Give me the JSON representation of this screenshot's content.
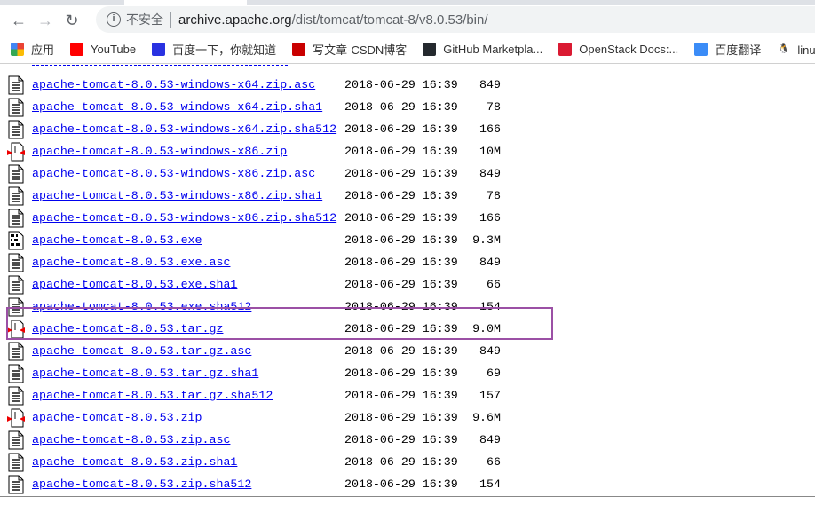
{
  "browser": {
    "back_icon": "arrow-left",
    "forward_icon": "arrow-right",
    "reload_icon": "reload",
    "security_label": "不安全",
    "url_host": "archive.apache.org",
    "url_path": "/dist/tomcat/tomcat-8/v8.0.53/bin/"
  },
  "bookmarks": [
    {
      "label": "应用",
      "icon": "apps-grid-icon",
      "color": "#4285f4"
    },
    {
      "label": "YouTube",
      "icon": "youtube-icon",
      "color": "#ff0000"
    },
    {
      "label": "百度一下，你就知道",
      "icon": "baidu-paw-icon",
      "color": "#2932e1"
    },
    {
      "label": "写文章-CSDN博客",
      "icon": "csdn-icon",
      "color": "#c90000"
    },
    {
      "label": "GitHub Marketpla...",
      "icon": "github-icon",
      "color": "#24292e"
    },
    {
      "label": "OpenStack Docs:...",
      "icon": "openstack-icon",
      "color": "#da1a32"
    },
    {
      "label": "百度翻译",
      "icon": "translate-icon",
      "color": "#3b8cf7"
    },
    {
      "label": "linux命",
      "icon": "linux-tux-icon",
      "color": "#333333"
    }
  ],
  "highlight_color": "#9b50a5",
  "files": [
    {
      "name": "apache-tomcat-8.0.53-windows-x64.zip.asc",
      "date": "2018-06-29 16:39",
      "size": "849",
      "type": "text"
    },
    {
      "name": "apache-tomcat-8.0.53-windows-x64.zip.sha1",
      "date": "2018-06-29 16:39",
      "size": "78",
      "type": "text"
    },
    {
      "name": "apache-tomcat-8.0.53-windows-x64.zip.sha512",
      "date": "2018-06-29 16:39",
      "size": "166",
      "type": "text"
    },
    {
      "name": "apache-tomcat-8.0.53-windows-x86.zip",
      "date": "2018-06-29 16:39",
      "size": "10M",
      "type": "compressed"
    },
    {
      "name": "apache-tomcat-8.0.53-windows-x86.zip.asc",
      "date": "2018-06-29 16:39",
      "size": "849",
      "type": "text"
    },
    {
      "name": "apache-tomcat-8.0.53-windows-x86.zip.sha1",
      "date": "2018-06-29 16:39",
      "size": "78",
      "type": "text"
    },
    {
      "name": "apache-tomcat-8.0.53-windows-x86.zip.sha512",
      "date": "2018-06-29 16:39",
      "size": "166",
      "type": "text"
    },
    {
      "name": "apache-tomcat-8.0.53.exe",
      "date": "2018-06-29 16:39",
      "size": "9.3M",
      "type": "binary"
    },
    {
      "name": "apache-tomcat-8.0.53.exe.asc",
      "date": "2018-06-29 16:39",
      "size": "849",
      "type": "text"
    },
    {
      "name": "apache-tomcat-8.0.53.exe.sha1",
      "date": "2018-06-29 16:39",
      "size": "66",
      "type": "text"
    },
    {
      "name": "apache-tomcat-8.0.53.exe.sha512",
      "date": "2018-06-29 16:39",
      "size": "154",
      "type": "text"
    },
    {
      "name": "apache-tomcat-8.0.53.tar.gz",
      "date": "2018-06-29 16:39",
      "size": "9.0M",
      "type": "compressed",
      "highlighted": true
    },
    {
      "name": "apache-tomcat-8.0.53.tar.gz.asc",
      "date": "2018-06-29 16:39",
      "size": "849",
      "type": "text"
    },
    {
      "name": "apache-tomcat-8.0.53.tar.gz.sha1",
      "date": "2018-06-29 16:39",
      "size": "69",
      "type": "text"
    },
    {
      "name": "apache-tomcat-8.0.53.tar.gz.sha512",
      "date": "2018-06-29 16:39",
      "size": "157",
      "type": "text"
    },
    {
      "name": "apache-tomcat-8.0.53.zip",
      "date": "2018-06-29 16:39",
      "size": "9.6M",
      "type": "compressed"
    },
    {
      "name": "apache-tomcat-8.0.53.zip.asc",
      "date": "2018-06-29 16:39",
      "size": "849",
      "type": "text"
    },
    {
      "name": "apache-tomcat-8.0.53.zip.sha1",
      "date": "2018-06-29 16:39",
      "size": "66",
      "type": "text"
    },
    {
      "name": "apache-tomcat-8.0.53.zip.sha512",
      "date": "2018-06-29 16:39",
      "size": "154",
      "type": "text"
    }
  ]
}
